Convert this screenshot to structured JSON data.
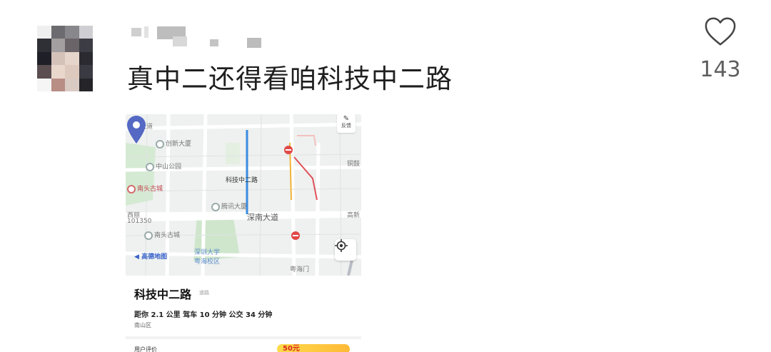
{
  "comment": {
    "text": "真中二还得看咱科技中二路"
  },
  "like": {
    "icon": "heart-outline-icon",
    "count": "143"
  },
  "map_card": {
    "feedback_label": "反馈",
    "brand_label": "高德地图",
    "pin_label": "科技中二路",
    "labels": {
      "road_top_left": "北环大道",
      "poi_chuangxin": "创新大厦",
      "poi_zhongshan_park": "中山公园",
      "poi_nantou_city": "南头古城",
      "poi_tencent": "腾讯大厦",
      "road_shennan": "深南大道",
      "poi_nantou_gucheng": "南头古城",
      "poi_szu": "深圳大学\n粤海校区",
      "poi_yuehaimen": "粤海门",
      "poi_tonggu": "铜鼓",
      "poi_gaoxin": "高新",
      "poi_xili": "西丽",
      "poi_code": "101350"
    },
    "place": {
      "name": "科技中二路",
      "type": "道路",
      "distance": "距你 2.1 公里  驾车 10 分钟  公交 34 分钟",
      "district": "南山区"
    },
    "bottom_label": "用户评价",
    "promo_label": "50元"
  },
  "colors": {
    "pin": "#5468c4",
    "route": "#3a8be0",
    "park": "#cfe8cf"
  }
}
